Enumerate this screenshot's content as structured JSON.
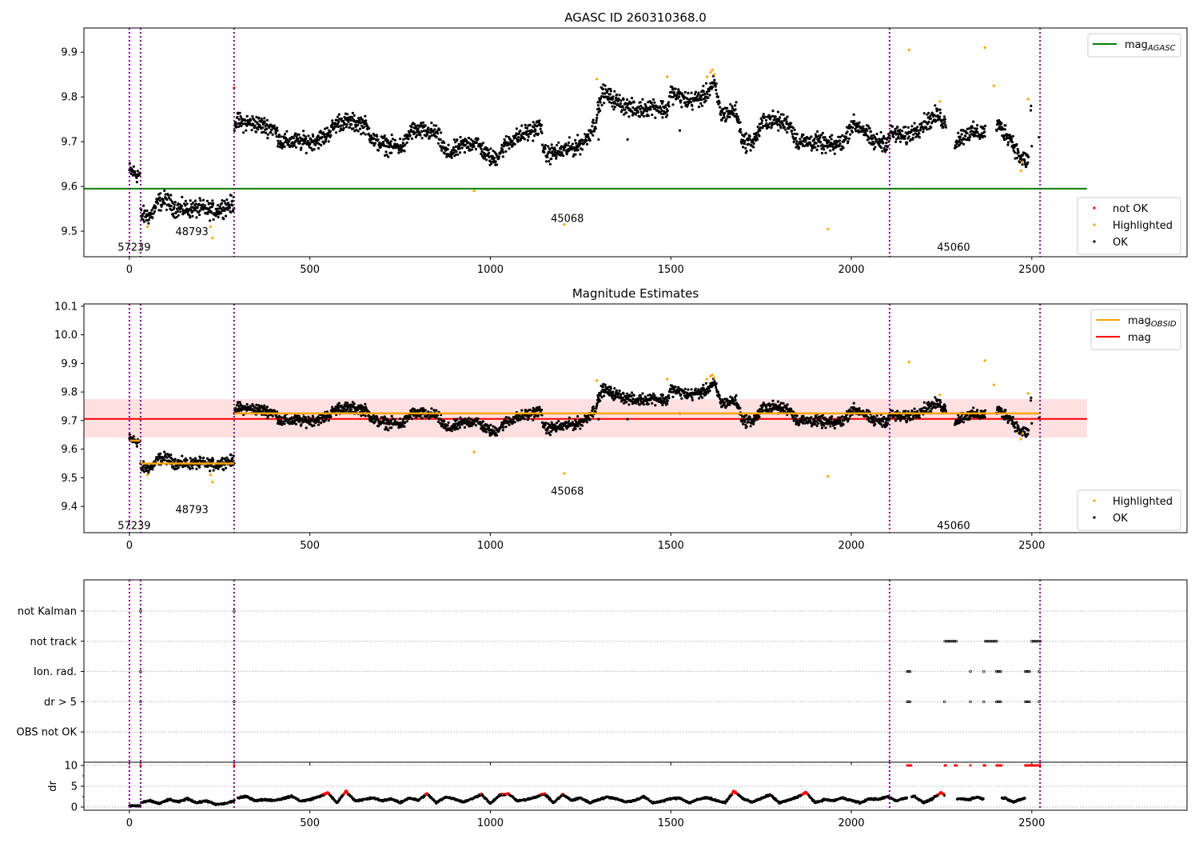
{
  "chart_data": {
    "type": "scatter",
    "x_range": [
      -126,
      2930
    ],
    "x_ticks": [
      0,
      500,
      1000,
      1500,
      2000,
      2500
    ],
    "obsid_boundaries": [
      0,
      31,
      290,
      2106,
      2523
    ],
    "obsid_labels": [
      {
        "text": "57239",
        "x": 0,
        "y_top": 9.465,
        "y_mid": 9.335
      },
      {
        "text": "48793",
        "x": 160,
        "y_top": 9.5,
        "y_mid": 9.39
      },
      {
        "text": "45068",
        "x": 1200,
        "y_top": 9.53,
        "y_mid": 9.455
      },
      {
        "text": "45060",
        "x": 2270,
        "y_top": 9.465,
        "y_mid": 9.335
      }
    ],
    "colors": {
      "ok": "#000000",
      "highlighted": "#ffa500",
      "not_ok": "#ff0000",
      "agasc": "#008000",
      "obsid": "#ffa500",
      "mag": "#ff0000",
      "band": "#ffe0e0",
      "boundary": "#800080"
    },
    "scatter": 0.014,
    "mag_segments": [
      [
        [
          0,
          9.635
        ],
        [
          30,
          9.625
        ]
      ],
      [
        [
          31,
          9.535
        ],
        [
          60,
          9.535
        ],
        [
          80,
          9.565
        ],
        [
          100,
          9.57
        ],
        [
          130,
          9.55
        ],
        [
          200,
          9.55
        ],
        [
          240,
          9.545
        ],
        [
          260,
          9.555
        ],
        [
          290,
          9.56
        ]
      ],
      [
        [
          291,
          9.745
        ],
        [
          350,
          9.74
        ],
        [
          400,
          9.73
        ],
        [
          420,
          9.7
        ],
        [
          500,
          9.7
        ],
        [
          540,
          9.71
        ],
        [
          580,
          9.745
        ],
        [
          650,
          9.74
        ],
        [
          680,
          9.7
        ],
        [
          720,
          9.69
        ],
        [
          760,
          9.69
        ],
        [
          780,
          9.725
        ],
        [
          850,
          9.72
        ],
        [
          880,
          9.67
        ],
        [
          920,
          9.69
        ],
        [
          960,
          9.7
        ],
        [
          990,
          9.67
        ],
        [
          1010,
          9.66
        ],
        [
          1050,
          9.7
        ],
        [
          1100,
          9.72
        ],
        [
          1140,
          9.735
        ],
        [
          1150,
          9.67
        ],
        [
          1200,
          9.68
        ],
        [
          1240,
          9.69
        ],
        [
          1260,
          9.7
        ],
        [
          1290,
          9.74
        ],
        [
          1310,
          9.81
        ],
        [
          1350,
          9.79
        ],
        [
          1400,
          9.77
        ],
        [
          1450,
          9.78
        ],
        [
          1490,
          9.77
        ],
        [
          1500,
          9.81
        ],
        [
          1550,
          9.79
        ],
        [
          1590,
          9.8
        ],
        [
          1620,
          9.83
        ],
        [
          1640,
          9.76
        ],
        [
          1680,
          9.77
        ],
        [
          1700,
          9.7
        ],
        [
          1730,
          9.7
        ],
        [
          1760,
          9.75
        ],
        [
          1830,
          9.74
        ],
        [
          1850,
          9.7
        ],
        [
          1900,
          9.7
        ],
        [
          1950,
          9.69
        ],
        [
          1980,
          9.7
        ],
        [
          2000,
          9.74
        ],
        [
          2030,
          9.73
        ],
        [
          2060,
          9.7
        ],
        [
          2100,
          9.7
        ],
        [
          2110,
          9.72
        ],
        [
          2150,
          9.71
        ],
        [
          2200,
          9.74
        ],
        [
          2240,
          9.76
        ],
        [
          2262,
          9.74
        ]
      ],
      [
        [
          2287,
          9.7
        ],
        [
          2320,
          9.72
        ],
        [
          2350,
          9.72
        ],
        [
          2371,
          9.72
        ]
      ],
      [
        [
          2402,
          9.74
        ],
        [
          2440,
          9.71
        ],
        [
          2470,
          9.66
        ],
        [
          2491,
          9.66
        ]
      ]
    ],
    "ok_extra": [
      [
        2497,
        9.77
      ],
      [
        2498,
        9.78
      ],
      [
        2500,
        9.69
      ],
      [
        2520,
        9.71
      ],
      [
        1300,
        9.705
      ],
      [
        1380,
        9.705
      ],
      [
        1525,
        9.725
      ]
    ],
    "highlighted": [
      [
        50,
        9.51
      ],
      [
        225,
        9.51
      ],
      [
        230,
        9.485
      ],
      [
        955,
        9.59
      ],
      [
        1205,
        9.515
      ],
      [
        1295,
        9.84
      ],
      [
        1490,
        9.845
      ],
      [
        1600,
        9.845
      ],
      [
        1610,
        9.855
      ],
      [
        1615,
        9.86
      ],
      [
        1620,
        9.85
      ],
      [
        1935,
        9.505
      ],
      [
        2160,
        9.905
      ],
      [
        2245,
        9.79
      ],
      [
        2370,
        9.91
      ],
      [
        2395,
        9.825
      ],
      [
        2470,
        9.635
      ],
      [
        2475,
        9.655
      ],
      [
        2490,
        9.795
      ]
    ],
    "not_ok": [
      [
        290,
        9.82
      ]
    ],
    "panels": {
      "top": {
        "title": "AGASC ID 260310368.0",
        "y_range": [
          9.443,
          9.954
        ],
        "y_ticks": [
          9.5,
          9.6,
          9.7,
          9.8,
          9.9
        ],
        "mag_agasc": 9.595,
        "line_x_range": [
          -126,
          2653
        ],
        "legend_lines": [
          {
            "label": "mag",
            "sub": "AGASC",
            "color": "#008000"
          }
        ],
        "legend_points": [
          {
            "label": "not OK",
            "color": "#ff0000"
          },
          {
            "label": "Highlighted",
            "color": "#ffa500"
          },
          {
            "label": "OK",
            "color": "#000000"
          }
        ]
      },
      "middle": {
        "title": "Magnitude Estimates",
        "y_range": [
          9.308,
          10.108
        ],
        "y_ticks": [
          9.4,
          9.5,
          9.6,
          9.7,
          9.8,
          9.9,
          10.0,
          10.1
        ],
        "mag": 9.706,
        "mag_band": [
          9.64,
          9.775
        ],
        "mag_obsid": [
          [
            0,
            31,
            9.63
          ],
          [
            31,
            290,
            9.55
          ],
          [
            290,
            2523,
            9.725
          ]
        ],
        "line_x_range": [
          -126,
          2653
        ],
        "legend_lines": [
          {
            "label": "mag",
            "sub": "OBSID",
            "color": "#ffa500"
          },
          {
            "label": "mag",
            "sub": "",
            "color": "#ff0000"
          }
        ],
        "legend_points": [
          {
            "label": "Highlighted",
            "color": "#ffa500"
          },
          {
            "label": "OK",
            "color": "#000000"
          }
        ]
      },
      "flags": {
        "categories": [
          "OBS not OK",
          "dr > 5",
          "Ion. rad.",
          "not track",
          "not Kalman"
        ],
        "y_range": [
          -1,
          5.03
        ],
        "ranges": {
          "not Kalman": [
            [
              31,
              31
            ],
            [
              290,
              290
            ]
          ],
          "not track": [
            [
              2259,
              2292
            ],
            [
              2371,
              2405
            ],
            [
              2500,
              2527
            ]
          ],
          "Ion. rad.": [
            [
              31,
              31
            ],
            [
              2155,
              2166
            ],
            [
              2330,
              2330
            ],
            [
              2367,
              2367
            ],
            [
              2402,
              2416
            ],
            [
              2482,
              2496
            ],
            [
              2520,
              2520
            ]
          ],
          "dr > 5": [
            [
              31,
              31
            ],
            [
              290,
              290
            ],
            [
              2155,
              2166
            ],
            [
              2258,
              2258
            ],
            [
              2330,
              2330
            ],
            [
              2367,
              2367
            ],
            [
              2402,
              2416
            ],
            [
              2482,
              2496
            ],
            [
              2520,
              2520
            ]
          ],
          "OBS not OK": []
        }
      },
      "dr": {
        "ylabel": "dr",
        "y_range": [
          -0.77,
          10.77
        ],
        "y_ticks": [
          0,
          5,
          10
        ],
        "red_threshold": 3,
        "seg_a": [
          [
            0,
            0.3
          ],
          [
            30,
            0.3
          ]
        ],
        "seg_b_start": 31,
        "seg_b_step": 26,
        "seg_b": [
          1.0,
          1.5,
          0.8,
          1.8,
          1.2,
          2.0,
          1.0,
          1.5,
          0.6,
          0.8,
          1.5
        ],
        "seg_c_start": 300,
        "seg_c_step": 25,
        "seg_c": [
          2.2,
          2.5,
          1.5,
          1.8,
          1.6,
          2.0,
          2.6,
          1.4,
          1.8,
          2.5,
          3.4,
          1.0,
          3.8,
          1.5,
          1.8,
          2.2,
          1.5,
          2.0,
          1.0,
          2.2,
          1.6,
          3.2,
          1.0,
          2.4,
          2.0,
          1.2,
          2.0,
          3.1,
          0.8,
          2.8,
          3.2,
          1.4,
          1.8,
          2.4,
          3.2,
          1.0,
          3.0,
          1.6,
          2.2,
          1.0,
          1.8,
          2.4,
          2.0,
          1.2,
          1.6,
          2.5,
          1.0,
          1.4,
          2.0,
          2.2,
          1.0,
          1.8,
          2.3,
          1.6,
          1.0,
          3.8,
          2.0,
          1.2,
          2.0,
          3.0,
          1.0,
          1.6,
          2.4,
          3.5,
          1.0,
          1.8,
          1.5,
          2.2,
          1.6,
          1.0,
          2.0,
          1.8,
          2.5,
          1.5,
          2.2,
          2.6,
          1.0,
          2.0,
          3.5,
          1.5,
          2.0,
          1.8,
          2.4,
          1.6,
          2.0,
          2.2,
          1.2,
          2.0,
          2.4,
          1.0
        ],
        "capped": [
          [
            31,
            31
          ],
          [
            290,
            290
          ],
          [
            2155,
            2166
          ],
          [
            2259,
            2292
          ],
          [
            2330,
            2330
          ],
          [
            2367,
            2416
          ],
          [
            2482,
            2527
          ]
        ],
        "cap_value": 10
      }
    }
  }
}
